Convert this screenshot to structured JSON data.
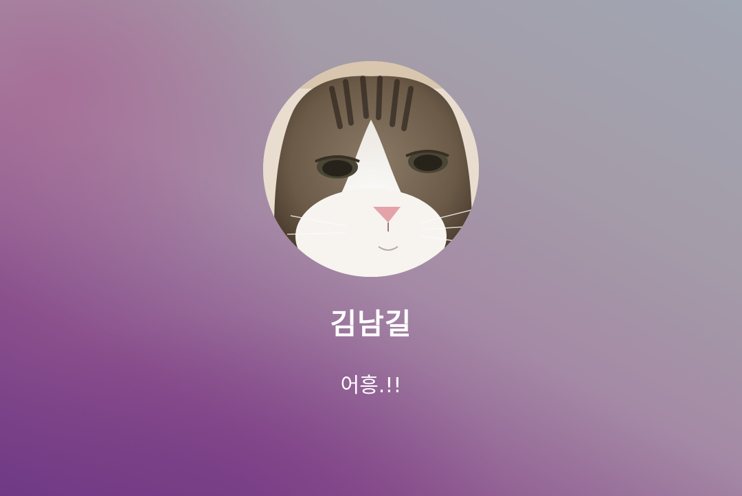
{
  "profile": {
    "name": "김남길",
    "status_message": "어흥.!!",
    "avatar_subject": "cat-photo"
  },
  "colors": {
    "text": "#ffffff",
    "bg_left": "#7a3f8a",
    "bg_right": "#a0a6b2"
  }
}
